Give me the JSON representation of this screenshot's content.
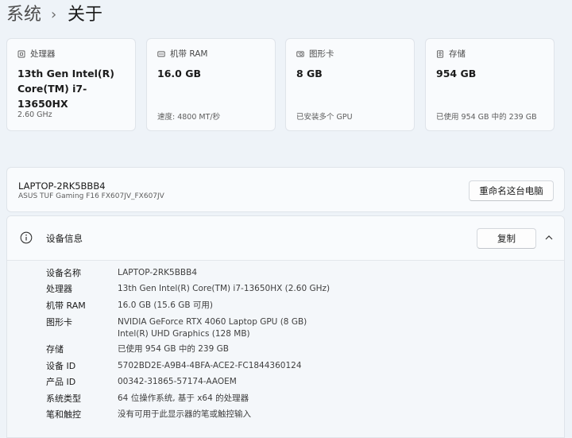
{
  "breadcrumb": {
    "parent": "系统",
    "separator": "›",
    "current": "关于"
  },
  "cards": [
    {
      "icon": "processor-icon",
      "title": "处理器",
      "value": "13th Gen Intel(R) Core(TM) i7-13650HX",
      "sub": "2.60 GHz"
    },
    {
      "icon": "ram-icon",
      "title": "机带 RAM",
      "value": "16.0 GB",
      "sub": "速度: 4800 MT/秒"
    },
    {
      "icon": "graphics-card-icon",
      "title": "图形卡",
      "value": "8 GB",
      "sub": "已安装多个 GPU"
    },
    {
      "icon": "storage-icon",
      "title": "存储",
      "value": "954 GB",
      "sub": "已使用 954 GB 中的 239 GB"
    }
  ],
  "device": {
    "name": "LAPTOP-2RK5BBB4",
    "model": "ASUS TUF Gaming F16 FX607JV_FX607JV",
    "rename_label": "重命名这台电脑"
  },
  "device_info": {
    "title": "设备信息",
    "copy_label": "复制",
    "rows": [
      {
        "label": "设备名称",
        "values": [
          "LAPTOP-2RK5BBB4"
        ]
      },
      {
        "label": "处理器",
        "values": [
          "13th Gen Intel(R) Core(TM) i7-13650HX (2.60 GHz)"
        ]
      },
      {
        "label": "机带 RAM",
        "values": [
          "16.0 GB (15.6 GB 可用)"
        ]
      },
      {
        "label": "图形卡",
        "values": [
          "NVIDIA GeForce RTX 4060 Laptop GPU (8 GB)",
          "Intel(R) UHD Graphics (128 MB)"
        ]
      },
      {
        "label": "存储",
        "values": [
          "已使用 954 GB 中的 239 GB"
        ]
      },
      {
        "label": "设备 ID",
        "values": [
          "5702BD2E-A9B4-4BFA-ACE2-FC1844360124"
        ]
      },
      {
        "label": "产品 ID",
        "values": [
          "00342-31865-57174-AAOEM"
        ]
      },
      {
        "label": "系统类型",
        "values": [
          "64 位操作系统, 基于 x64 的处理器"
        ]
      },
      {
        "label": "笔和触控",
        "values": [
          "没有可用于此显示器的笔或触控输入"
        ]
      }
    ]
  }
}
